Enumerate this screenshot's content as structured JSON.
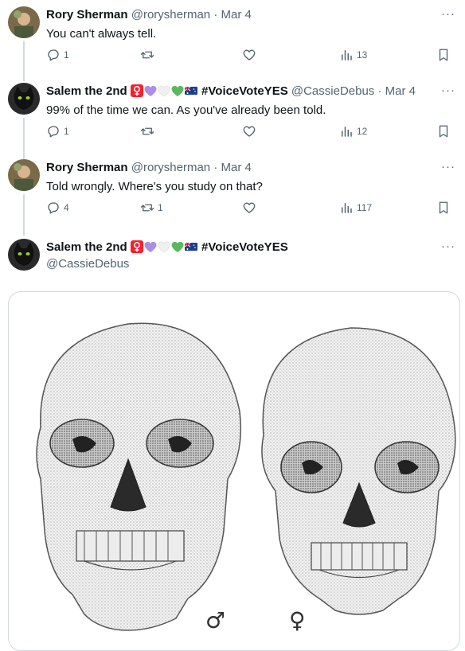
{
  "tweets": [
    {
      "name": "Rory Sherman",
      "handle": "@rorysherman",
      "date": "Mar 4",
      "text": "You can't always tell.",
      "replies": "1",
      "retweets": "",
      "views": "13"
    },
    {
      "name": "Salem the 2nd",
      "hashtag": "#VoiceVoteYES",
      "handle": "@CassieDebus",
      "date": "Mar 4",
      "text": "99% of the time we can. As you've already been told.",
      "replies": "1",
      "retweets": "",
      "views": "12"
    },
    {
      "name": "Rory Sherman",
      "handle": "@rorysherman",
      "date": "Mar 4",
      "text": "Told wrongly. Where's you study on that?",
      "replies": "4",
      "retweets": "1",
      "views": "117"
    },
    {
      "name": "Salem the 2nd",
      "hashtag": "#VoiceVoteYES",
      "handle": "@CassieDebus"
    }
  ],
  "separator_dot": "·",
  "more_label": "···",
  "media": {
    "male_symbol": "♂",
    "female_symbol": "♀"
  },
  "icons": [
    "reply-icon",
    "retweet-icon",
    "like-icon",
    "views-icon",
    "bookmark-icon",
    "more-icon"
  ],
  "colors": {
    "secondary_text": "#536471",
    "thread_line": "#cfd9de",
    "female_sign_bg": "#f4212e",
    "purple_heart": "#ab8ee5",
    "green_heart": "#4caf50"
  }
}
